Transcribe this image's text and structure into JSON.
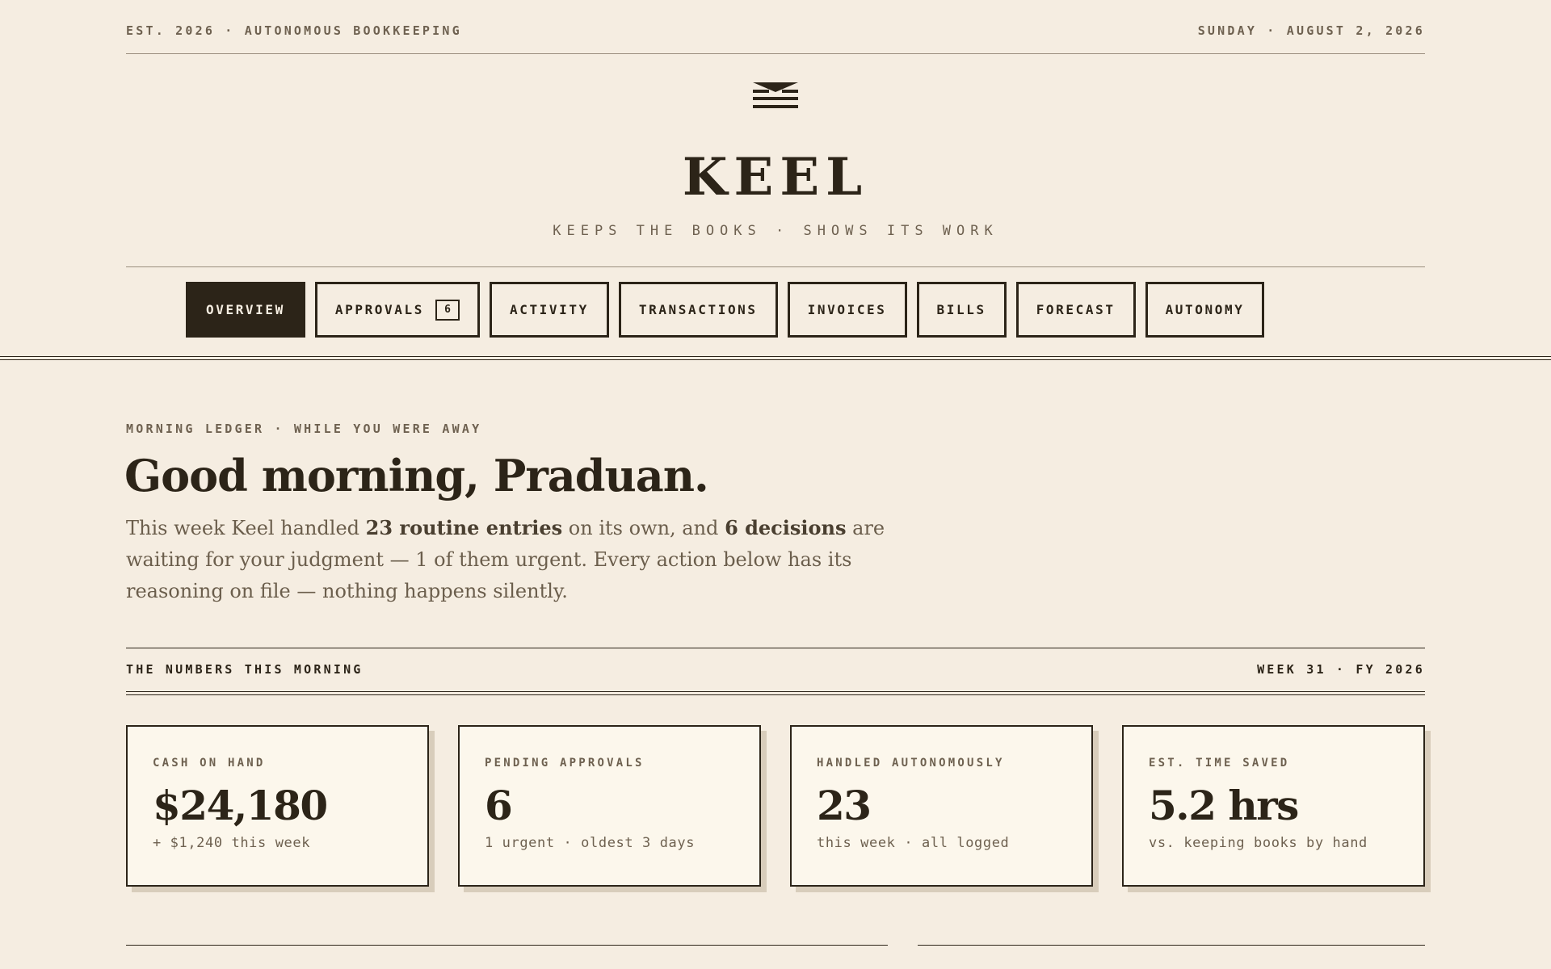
{
  "topbar": {
    "left": "EST. 2026 · AUTONOMOUS BOOKKEEPING",
    "right": "SUNDAY · AUGUST 2, 2026"
  },
  "brand": {
    "logo_icon": "stacked-ledger-logo",
    "name": "KEEL",
    "tagline": "KEEPS THE BOOKS · SHOWS ITS WORK"
  },
  "nav": {
    "tabs": [
      {
        "label": "OVERVIEW",
        "active": true
      },
      {
        "label": "APPROVALS",
        "badge": "6"
      },
      {
        "label": "ACTIVITY"
      },
      {
        "label": "TRANSACTIONS"
      },
      {
        "label": "INVOICES"
      },
      {
        "label": "BILLS"
      },
      {
        "label": "FORECAST"
      },
      {
        "label": "AUTONOMY"
      }
    ]
  },
  "greeting": {
    "kicker": "MORNING LEDGER · WHILE YOU WERE AWAY",
    "title": "Good morning, Praduan.",
    "lede_1": "This week Keel handled ",
    "lede_strong_1": "23 routine entries",
    "lede_2": " on its own, and ",
    "lede_strong_2": "6 decisions",
    "lede_3": " are waiting for your judgment — 1 of them urgent. Every action below has its reasoning on file — nothing happens silently."
  },
  "numbers": {
    "heading": "THE NUMBERS THIS MORNING",
    "period": "WEEK 31 · FY 2026",
    "cards": [
      {
        "label": "CASH ON HAND",
        "value": "$24,180",
        "note": "+ $1,240 this week"
      },
      {
        "label": "PENDING APPROVALS",
        "value": "6",
        "note": "1 urgent · oldest 3 days"
      },
      {
        "label": "HANDLED AUTONOMOUSLY",
        "value": "23",
        "note": "this week · all logged"
      },
      {
        "label": "EST. TIME SAVED",
        "value": "5.2 hrs",
        "note": "vs. keeping books by hand"
      }
    ]
  },
  "colors": {
    "background": "#f5ede1",
    "ink": "#2c2418",
    "muted": "#6e6150",
    "card": "#fcf7ec"
  }
}
